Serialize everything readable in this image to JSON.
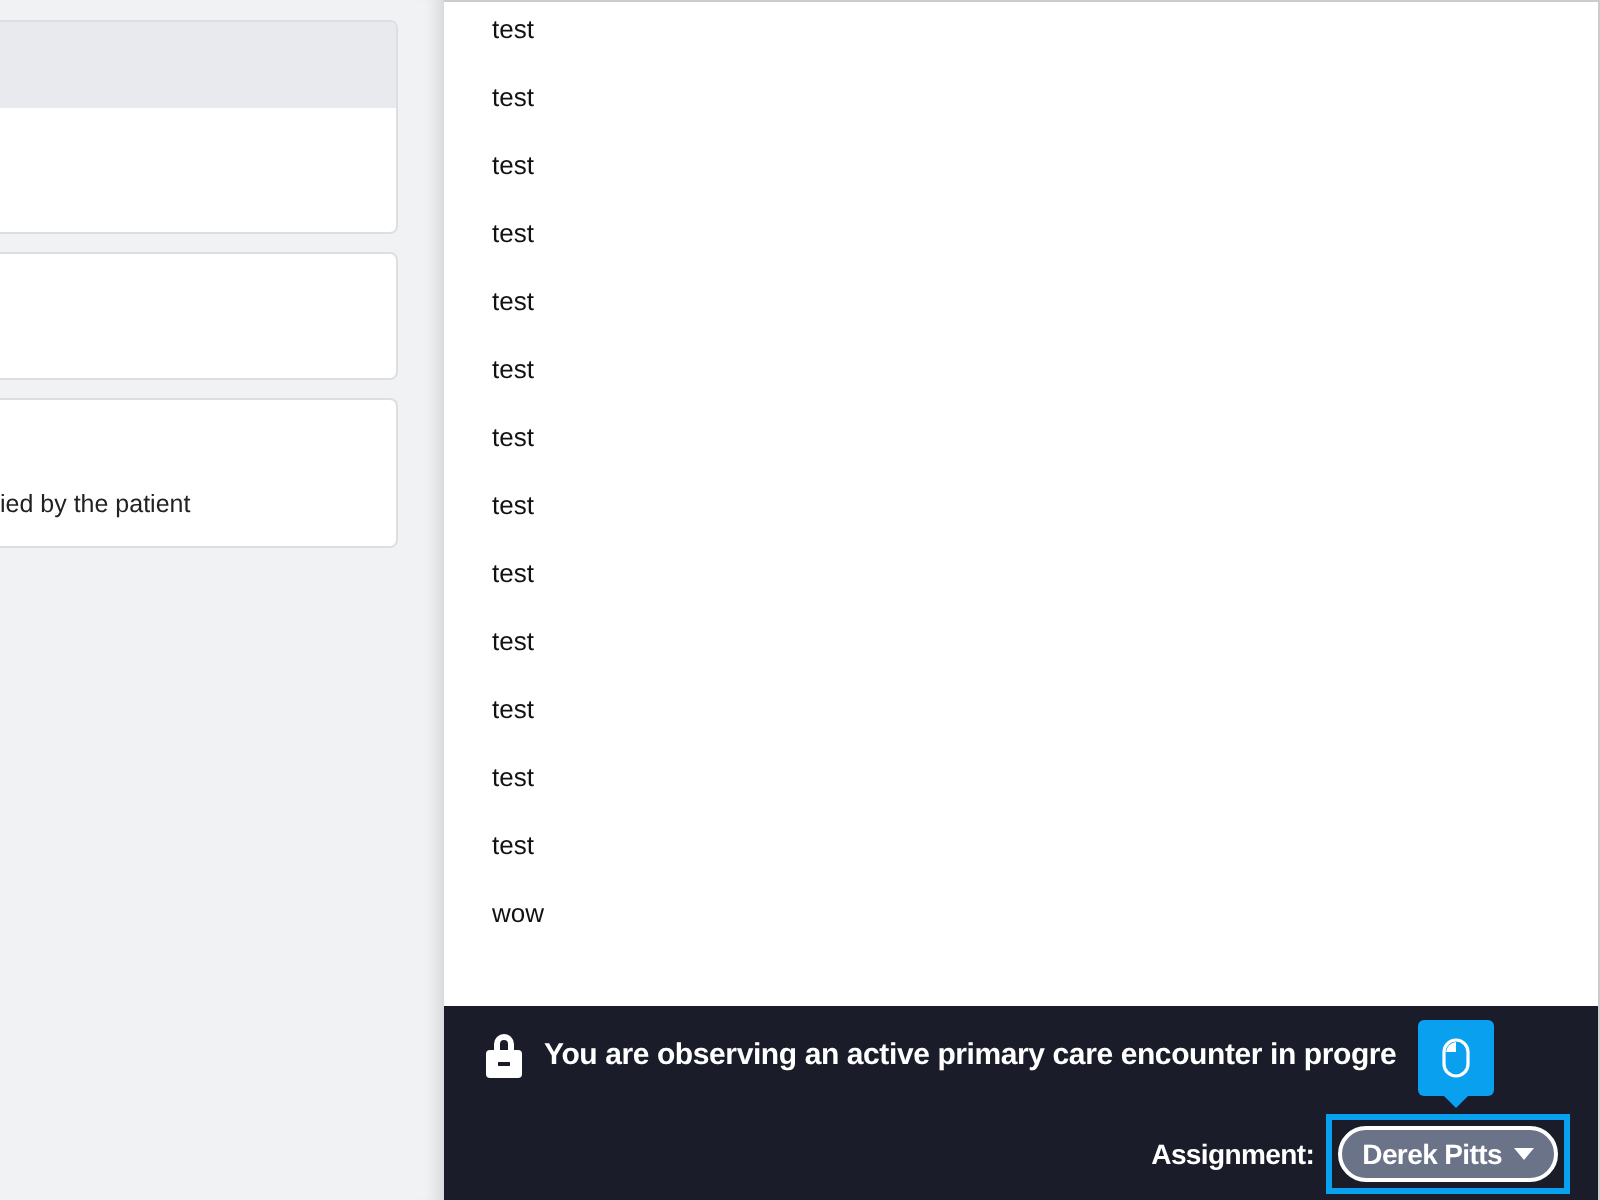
{
  "left_cards": [
    {
      "has_header": true
    },
    {
      "has_header": false
    },
    {
      "has_header": false,
      "text": "ied by the patient"
    }
  ],
  "items": [
    "test",
    "test",
    "test",
    "test",
    "test",
    "test",
    "test",
    "test",
    "test",
    "test",
    "test",
    "test",
    "test",
    "wow"
  ],
  "banner": {
    "message": "You are observing an active primary care encounter in progre",
    "assignment_label": "Assignment:",
    "assignee": "Derek Pitts",
    "highlighted": true
  }
}
